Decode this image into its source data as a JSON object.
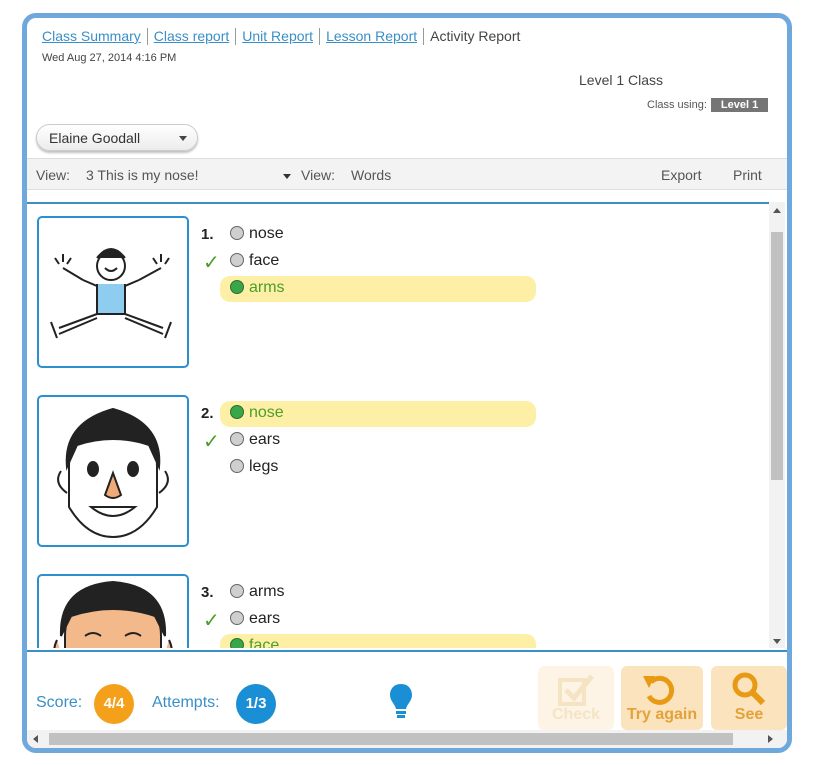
{
  "breadcrumbs": {
    "class_summary": "Class Summary",
    "class_report": "Class report",
    "unit_report": "Unit Report",
    "lesson_report": "Lesson Report",
    "activity_report": "Activity Report"
  },
  "date": "Wed Aug 27, 2014 4:16 PM",
  "level_class": "Level 1 Class",
  "class_using": {
    "label": "Class using:",
    "badge": "Level 1"
  },
  "student": "Elaine Goodall",
  "viewbar": {
    "view1_label": "View:",
    "view1_value": "3 This is my nose!",
    "view2_label": "View:",
    "view2_value": "Words",
    "export": "Export",
    "print": "Print"
  },
  "questions": [
    {
      "num": "1.",
      "options": [
        "nose",
        "face",
        "arms"
      ]
    },
    {
      "num": "2.",
      "options": [
        "nose",
        "ears",
        "legs"
      ]
    },
    {
      "num": "3.",
      "options": [
        "arms",
        "ears",
        "face"
      ]
    }
  ],
  "check_mark": "✓",
  "footer": {
    "score_label": "Score:",
    "score": "4/4",
    "attempts_label": "Attempts:",
    "attempts": "1/3",
    "check_label": "Check",
    "try_again_label": "Try again",
    "see_label": "See"
  },
  "colors": {
    "accent_blue": "#3a8fc7",
    "score_orange": "#f5a01a",
    "attempts_blue": "#1a8fd6",
    "selected_bg": "#fdf0a6",
    "correct_green": "#4c9d2a"
  },
  "icons": [
    "check-icon",
    "undo-icon",
    "search-icon",
    "lightbulb-icon"
  ]
}
